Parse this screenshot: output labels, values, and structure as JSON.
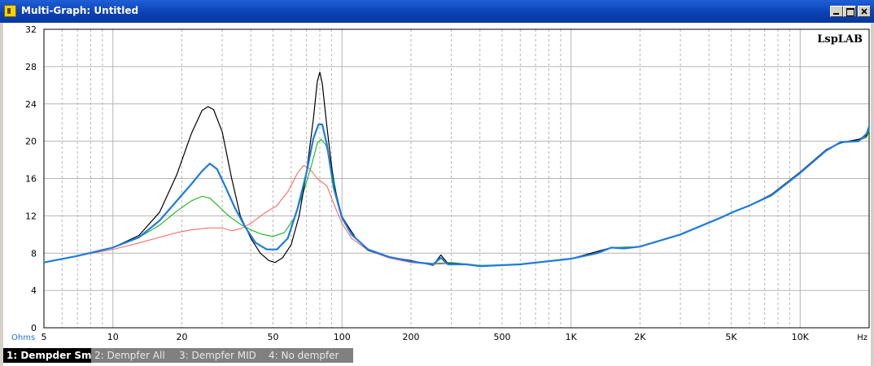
{
  "window": {
    "title": "Multi-Graph: Untitled",
    "buttons": [
      "minimize",
      "maximize",
      "close"
    ]
  },
  "watermark": "LspLAB",
  "tabs": [
    {
      "label": "1: Dempder Sm",
      "active": true
    },
    {
      "label": "2: Dempfer All",
      "active": false
    },
    {
      "label": "3: Dempfer MID",
      "active": false
    },
    {
      "label": "4: No dempfer",
      "active": false
    }
  ],
  "colors": {
    "grid": "#b4b4b4",
    "series1": "#1e7be0",
    "series2": "#000000",
    "series3": "#00b000",
    "series4": "#ff5a5a",
    "unit_label": "#2a6fd0"
  },
  "chart_data": {
    "type": "line",
    "title": "",
    "xlabel": "",
    "ylabel": "",
    "x_scale": "log",
    "xlim": [
      5,
      20000
    ],
    "ylim": [
      0,
      32
    ],
    "y_unit_label": "Ohms",
    "x_unit_label": "Hz",
    "x_ticks": [
      {
        "value": 5,
        "label": "5"
      },
      {
        "value": 10,
        "label": "10"
      },
      {
        "value": 20,
        "label": "20"
      },
      {
        "value": 50,
        "label": "50"
      },
      {
        "value": 100,
        "label": "100"
      },
      {
        "value": 200,
        "label": "200"
      },
      {
        "value": 500,
        "label": "500"
      },
      {
        "value": 1000,
        "label": "1K"
      },
      {
        "value": 2000,
        "label": "2K"
      },
      {
        "value": 5000,
        "label": "5K"
      },
      {
        "value": 10000,
        "label": "10K"
      }
    ],
    "y_ticks": [
      0,
      4,
      8,
      12,
      16,
      20,
      24,
      28,
      32
    ],
    "grid": true,
    "series": [
      {
        "name": "1: Dempder Sm",
        "color": "#1e7be0",
        "width": 2.2,
        "points": [
          [
            5,
            7.0
          ],
          [
            7,
            7.7
          ],
          [
            10,
            8.6
          ],
          [
            13,
            9.7
          ],
          [
            16,
            11.5
          ],
          [
            19,
            13.6
          ],
          [
            22,
            15.4
          ],
          [
            24.5,
            16.8
          ],
          [
            26.5,
            17.6
          ],
          [
            28.5,
            17.0
          ],
          [
            31,
            15.1
          ],
          [
            34,
            12.9
          ],
          [
            38,
            10.7
          ],
          [
            42,
            9.1
          ],
          [
            47,
            8.4
          ],
          [
            52,
            8.4
          ],
          [
            58,
            9.6
          ],
          [
            64,
            12.8
          ],
          [
            70,
            16.6
          ],
          [
            75,
            20.3
          ],
          [
            79,
            21.8
          ],
          [
            82,
            21.8
          ],
          [
            86,
            19.6
          ],
          [
            92,
            15.0
          ],
          [
            100,
            11.8
          ],
          [
            110,
            10.0
          ],
          [
            130,
            8.4
          ],
          [
            160,
            7.6
          ],
          [
            200,
            7.1
          ],
          [
            250,
            6.8
          ],
          [
            270,
            7.5
          ],
          [
            290,
            6.8
          ],
          [
            350,
            6.8
          ],
          [
            400,
            6.6
          ],
          [
            600,
            6.8
          ],
          [
            1000,
            7.4
          ],
          [
            1300,
            8.0
          ],
          [
            1500,
            8.6
          ],
          [
            1700,
            8.5
          ],
          [
            2000,
            8.7
          ],
          [
            3000,
            10.0
          ],
          [
            4500,
            11.8
          ],
          [
            5200,
            12.5
          ],
          [
            6000,
            13.1
          ],
          [
            7500,
            14.2
          ],
          [
            10000,
            16.6
          ],
          [
            13000,
            19.0
          ],
          [
            15000,
            19.9
          ],
          [
            18000,
            20.0
          ],
          [
            19500,
            20.8
          ],
          [
            20000,
            21.6
          ]
        ]
      },
      {
        "name": "2: Dempfer All",
        "color": "#000000",
        "width": 1.2,
        "points": [
          [
            5,
            7.0
          ],
          [
            7,
            7.7
          ],
          [
            10,
            8.6
          ],
          [
            13,
            9.9
          ],
          [
            16,
            12.4
          ],
          [
            19,
            16.4
          ],
          [
            22,
            20.8
          ],
          [
            24.5,
            23.3
          ],
          [
            26,
            23.7
          ],
          [
            27.5,
            23.4
          ],
          [
            30,
            21.0
          ],
          [
            33,
            16.0
          ],
          [
            36,
            12.0
          ],
          [
            40,
            9.6
          ],
          [
            44,
            8.0
          ],
          [
            48,
            7.2
          ],
          [
            51,
            7.0
          ],
          [
            55,
            7.5
          ],
          [
            60,
            8.9
          ],
          [
            65,
            12.0
          ],
          [
            70,
            16.6
          ],
          [
            75,
            22.4
          ],
          [
            78,
            26.4
          ],
          [
            80,
            27.4
          ],
          [
            82,
            26.2
          ],
          [
            86,
            21.5
          ],
          [
            92,
            15.4
          ],
          [
            100,
            11.9
          ],
          [
            115,
            9.6
          ],
          [
            130,
            8.3
          ],
          [
            160,
            7.6
          ],
          [
            200,
            7.2
          ],
          [
            250,
            6.7
          ],
          [
            270,
            7.8
          ],
          [
            290,
            6.9
          ],
          [
            350,
            6.8
          ],
          [
            400,
            6.6
          ],
          [
            600,
            6.8
          ],
          [
            1000,
            7.4
          ],
          [
            1500,
            8.6
          ],
          [
            1700,
            8.5
          ],
          [
            2000,
            8.7
          ],
          [
            3000,
            10.0
          ],
          [
            4500,
            11.8
          ],
          [
            5200,
            12.5
          ],
          [
            6000,
            13.1
          ],
          [
            7500,
            14.3
          ],
          [
            10000,
            16.7
          ],
          [
            13000,
            19.1
          ],
          [
            15000,
            19.8
          ],
          [
            18000,
            20.2
          ],
          [
            19500,
            20.6
          ],
          [
            20000,
            21.5
          ]
        ]
      },
      {
        "name": "3: Dempfer MID",
        "color": "#00b000",
        "width": 1.0,
        "points": [
          [
            5,
            7.0
          ],
          [
            7,
            7.7
          ],
          [
            10,
            8.6
          ],
          [
            13,
            9.7
          ],
          [
            16,
            11.0
          ],
          [
            19,
            12.5
          ],
          [
            22,
            13.6
          ],
          [
            24.5,
            14.1
          ],
          [
            26.5,
            13.9
          ],
          [
            29,
            13.0
          ],
          [
            32,
            12.0
          ],
          [
            36,
            11.1
          ],
          [
            40,
            10.5
          ],
          [
            45,
            10.0
          ],
          [
            50,
            9.8
          ],
          [
            56,
            10.2
          ],
          [
            62,
            11.8
          ],
          [
            68,
            14.6
          ],
          [
            74,
            17.6
          ],
          [
            78,
            19.8
          ],
          [
            81,
            20.2
          ],
          [
            85,
            19.6
          ],
          [
            90,
            17.4
          ],
          [
            95,
            14.0
          ],
          [
            100,
            12.0
          ],
          [
            110,
            10.0
          ],
          [
            130,
            8.3
          ],
          [
            160,
            7.6
          ],
          [
            200,
            7.1
          ],
          [
            250,
            6.9
          ],
          [
            300,
            7.0
          ],
          [
            400,
            6.7
          ],
          [
            600,
            6.8
          ],
          [
            1000,
            7.4
          ],
          [
            1500,
            8.6
          ],
          [
            2000,
            8.7
          ],
          [
            3000,
            10.0
          ],
          [
            4500,
            11.8
          ],
          [
            6000,
            13.1
          ],
          [
            7500,
            14.2
          ],
          [
            10000,
            16.6
          ],
          [
            13000,
            19.0
          ],
          [
            15000,
            19.9
          ],
          [
            18000,
            20.1
          ],
          [
            19500,
            20.4
          ],
          [
            20000,
            21.1
          ]
        ]
      },
      {
        "name": "4: No dempfer",
        "color": "#ff5a5a",
        "width": 1.0,
        "points": [
          [
            5,
            7.0
          ],
          [
            7,
            7.7
          ],
          [
            10,
            8.4
          ],
          [
            13,
            9.1
          ],
          [
            16,
            9.7
          ],
          [
            19,
            10.2
          ],
          [
            22,
            10.5
          ],
          [
            26,
            10.7
          ],
          [
            30,
            10.7
          ],
          [
            33,
            10.4
          ],
          [
            36,
            10.6
          ],
          [
            40,
            11.2
          ],
          [
            46,
            12.3
          ],
          [
            52,
            13.1
          ],
          [
            58,
            14.6
          ],
          [
            64,
            16.6
          ],
          [
            68,
            17.4
          ],
          [
            72,
            17.1
          ],
          [
            78,
            16.0
          ],
          [
            86,
            15.2
          ],
          [
            92,
            13.3
          ],
          [
            100,
            11.2
          ],
          [
            110,
            9.6
          ],
          [
            130,
            8.3
          ],
          [
            160,
            7.5
          ],
          [
            200,
            7.0
          ],
          [
            250,
            6.8
          ],
          [
            300,
            6.9
          ],
          [
            400,
            6.6
          ],
          [
            600,
            6.8
          ],
          [
            1000,
            7.4
          ],
          [
            1500,
            8.6
          ],
          [
            2000,
            8.7
          ],
          [
            3000,
            10.0
          ],
          [
            4500,
            11.8
          ],
          [
            6000,
            13.1
          ],
          [
            7500,
            14.3
          ],
          [
            10000,
            16.7
          ],
          [
            13000,
            19.1
          ],
          [
            15000,
            19.9
          ],
          [
            18000,
            20.2
          ],
          [
            19500,
            20.5
          ],
          [
            20000,
            21.2
          ]
        ]
      }
    ]
  }
}
